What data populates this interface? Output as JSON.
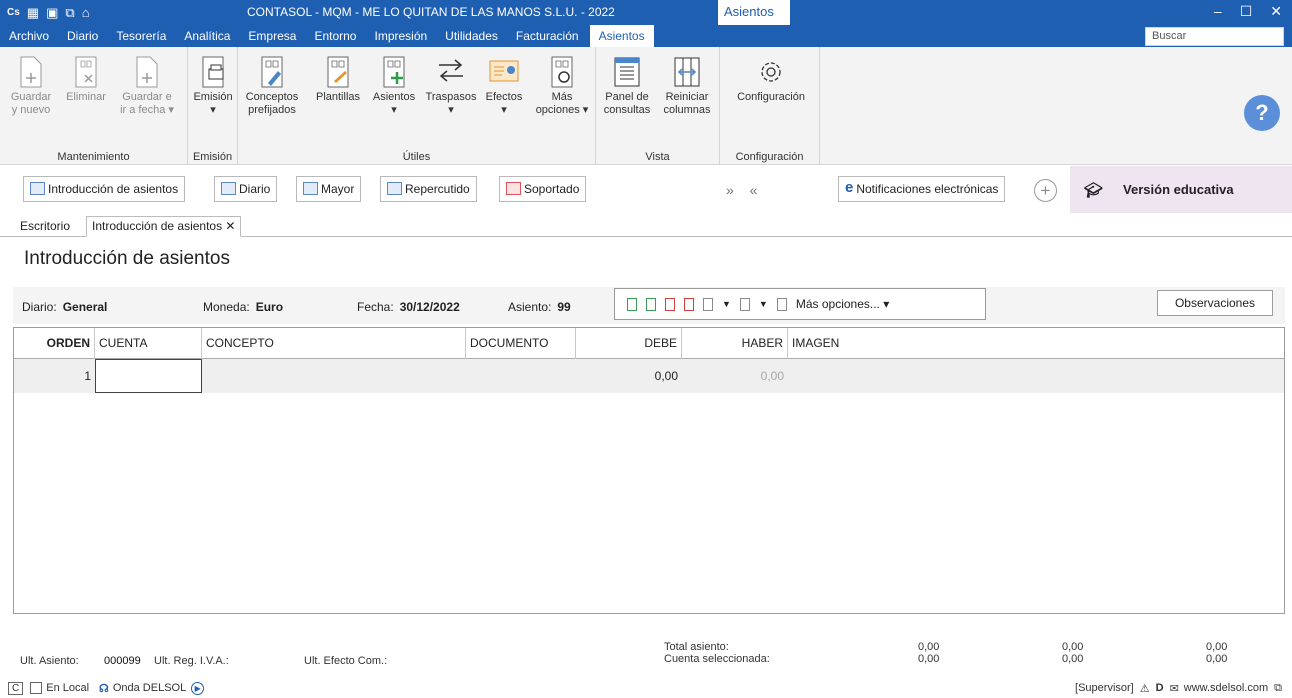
{
  "titlebar": {
    "title": "CONTASOL - MQM - ME LO QUITAN DE LAS MANOS S.L.U. - 2022",
    "context_tab": "Asientos",
    "minimize": "–",
    "maximize": "☐",
    "close": "✕"
  },
  "menu": {
    "items": [
      "Archivo",
      "Diario",
      "Tesorería",
      "Analítica",
      "Empresa",
      "Entorno",
      "Impresión",
      "Utilidades",
      "Facturación",
      "Asientos"
    ],
    "search_placeholder": "Buscar"
  },
  "ribbon": {
    "groups": {
      "mantenimiento": "Mantenimiento",
      "emision": "Emisión",
      "utiles": "Útiles",
      "vista": "Vista",
      "configuracion": "Configuración"
    },
    "buttons": {
      "guardar_nuevo_1": "Guardar",
      "guardar_nuevo_2": "y nuevo",
      "eliminar": "Eliminar",
      "guardar_fecha_1": "Guardar e",
      "guardar_fecha_2": "ir a fecha ▾",
      "emision_1": "Emisión",
      "emision_2": "▾",
      "conceptos_1": "Conceptos",
      "conceptos_2": "prefijados",
      "plantillas": "Plantillas",
      "asientos_1": "Asientos",
      "asientos_2": "▾",
      "traspasos_1": "Traspasos",
      "traspasos_2": "▾",
      "efectos_1": "Efectos",
      "efectos_2": "▾",
      "mas_1": "Más",
      "mas_2": "opciones ▾",
      "panel_1": "Panel de",
      "panel_2": "consultas",
      "reiniciar_1": "Reiniciar",
      "reiniciar_2": "columnas",
      "configuracion": "Configuración"
    },
    "help": "?"
  },
  "shortcuts": {
    "introduccion": "Introducción de asientos",
    "diario": "Diario",
    "mayor": "Mayor",
    "repercutido": "Repercutido",
    "soportado": "Soportado",
    "arrows": "» «",
    "notificaciones": "Notificaciones electrónicas",
    "plus": "+",
    "version": "Versión educativa"
  },
  "tabs": {
    "escritorio": "Escritorio",
    "introduccion": "Introducción de asientos ✕"
  },
  "page_title": "Introducción de asientos",
  "info": {
    "diario_label": "Diario:",
    "diario_value": "General",
    "moneda_label": "Moneda:",
    "moneda_value": "Euro",
    "fecha_label": "Fecha:",
    "fecha_value": "30/12/2022",
    "asiento_label": "Asiento:",
    "asiento_value": "99",
    "mas_opciones": "Más opciones... ▾",
    "observaciones": "Observaciones"
  },
  "grid": {
    "columns": [
      "ORDEN",
      "CUENTA",
      "CONCEPTO",
      "DOCUMENTO",
      "DEBE",
      "HABER",
      "IMAGEN"
    ],
    "rows": [
      {
        "orden": "1",
        "cuenta": "",
        "concepto": "",
        "documento": "",
        "debe": "0,00",
        "haber": "0,00",
        "imagen": ""
      }
    ]
  },
  "footer": {
    "ult_asiento_label": "Ult. Asiento:",
    "ult_asiento_value": "000099",
    "ult_reg_iva": "Ult. Reg. I.V.A.:",
    "ult_efecto": "Ult. Efecto Com.:",
    "total_asiento": "Total asiento:",
    "cuenta_sel": "Cuenta seleccionada:",
    "total_debe": "0,00",
    "total_haber": "0,00",
    "total_saldo": "0,00",
    "cuenta_debe": "0,00",
    "cuenta_haber": "0,00",
    "cuenta_saldo": "0,00"
  },
  "statusbar": {
    "c_label": "C",
    "en_local": "En Local",
    "onda": "Onda DELSOL",
    "supervisor": "[Supervisor]",
    "website": "www.sdelsol.com"
  },
  "colors": {
    "titlebar": "#1f5fb1",
    "ribbon": "#f3f3f3",
    "edu_bg": "#efe5f1",
    "help": "#5b8fd9"
  }
}
